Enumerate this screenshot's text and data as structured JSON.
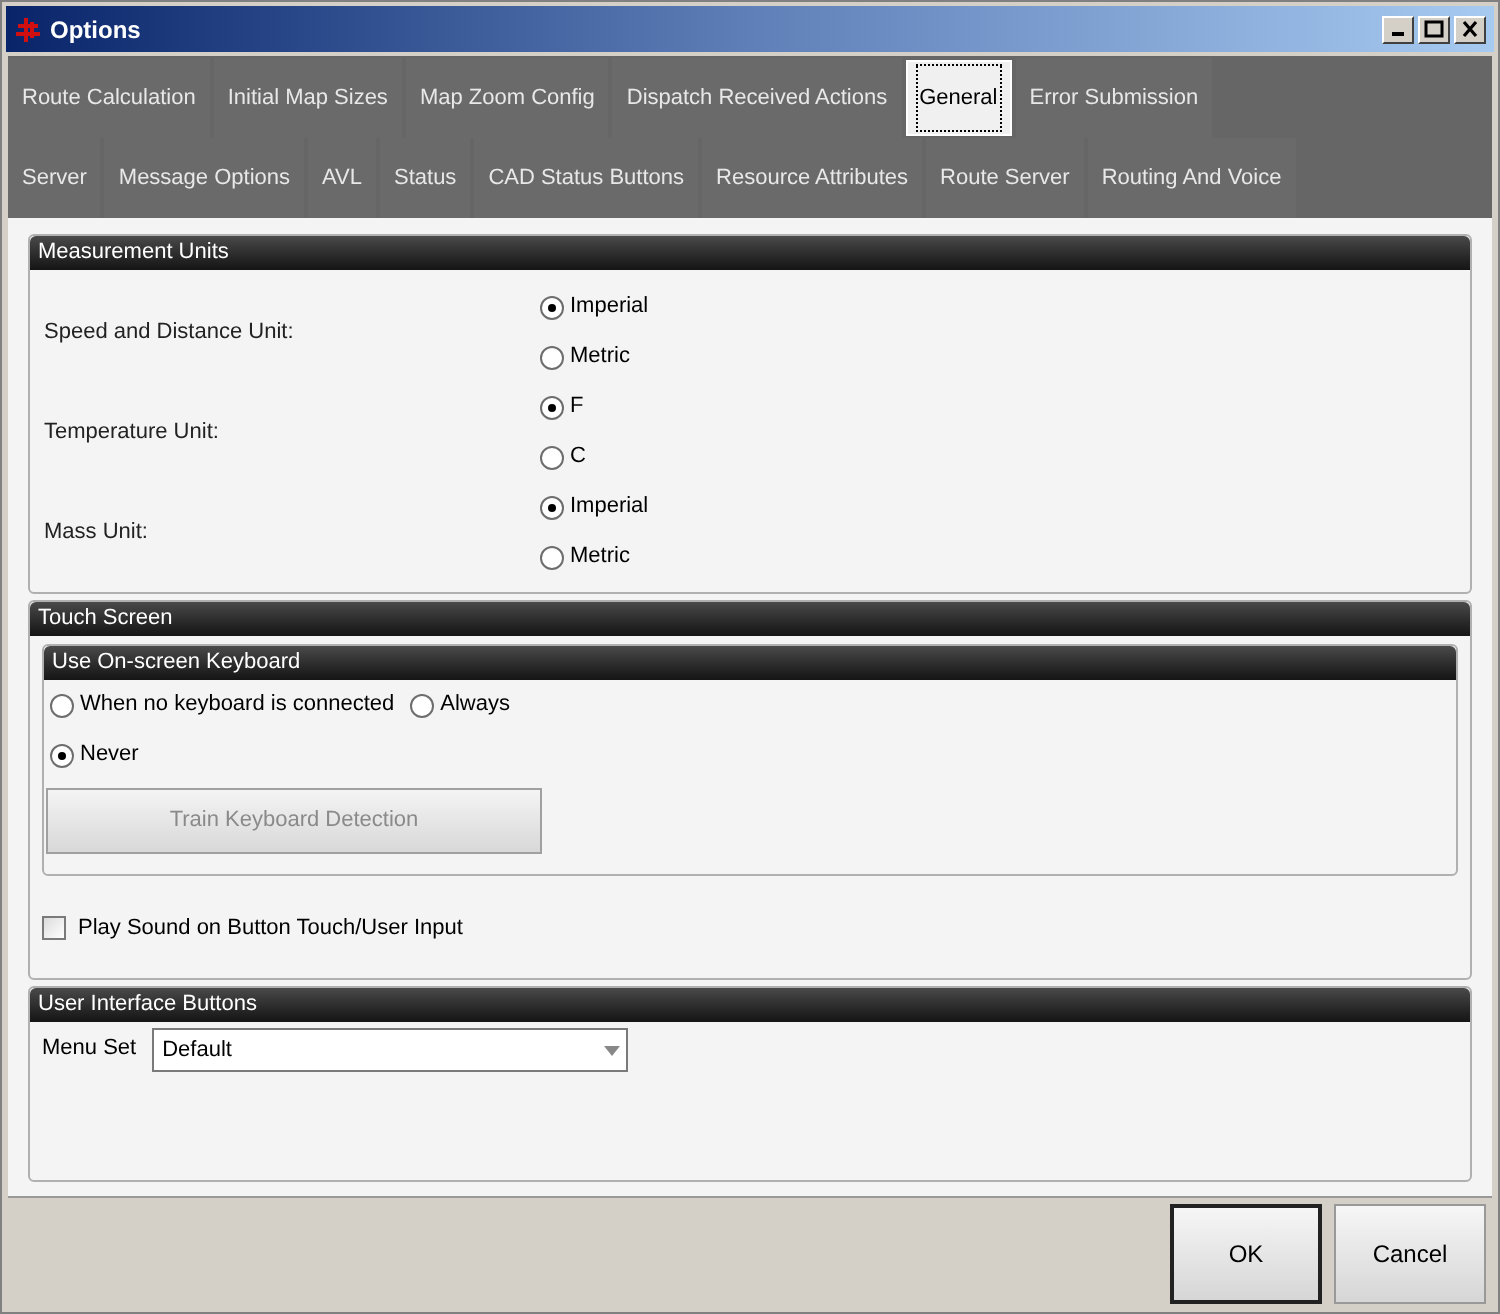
{
  "window": {
    "title": "Options"
  },
  "tab_rows": [
    [
      {
        "label": "Route Calculation",
        "selected": false
      },
      {
        "label": "Initial Map Sizes",
        "selected": false
      },
      {
        "label": "Map Zoom Config",
        "selected": false
      },
      {
        "label": "Dispatch Received Actions",
        "selected": false
      },
      {
        "label": "General",
        "selected": true
      },
      {
        "label": "Error Submission",
        "selected": false
      }
    ],
    [
      {
        "label": "Server",
        "selected": false
      },
      {
        "label": "Message Options",
        "selected": false
      },
      {
        "label": "AVL",
        "selected": false
      },
      {
        "label": "Status",
        "selected": false
      },
      {
        "label": "CAD Status Buttons",
        "selected": false
      },
      {
        "label": "Resource Attributes",
        "selected": false
      },
      {
        "label": "Route Server",
        "selected": false
      },
      {
        "label": "Routing And Voice",
        "selected": false
      }
    ]
  ],
  "measurement_units": {
    "title": "Measurement Units",
    "groups": [
      {
        "label": "Speed and Distance Unit:",
        "options": [
          {
            "label": "Imperial",
            "selected": true
          },
          {
            "label": "Metric",
            "selected": false
          }
        ]
      },
      {
        "label": "Temperature Unit:",
        "options": [
          {
            "label": "F",
            "selected": true
          },
          {
            "label": "C",
            "selected": false
          }
        ]
      },
      {
        "label": "Mass Unit:",
        "options": [
          {
            "label": "Imperial",
            "selected": true
          },
          {
            "label": "Metric",
            "selected": false
          }
        ]
      }
    ]
  },
  "touch_screen": {
    "title": "Touch Screen",
    "keyboard": {
      "title": "Use On-screen Keyboard",
      "options": [
        {
          "label": "When no keyboard is connected",
          "selected": false
        },
        {
          "label": "Always",
          "selected": false
        },
        {
          "label": "Never",
          "selected": true
        }
      ],
      "train_button": {
        "label": "Train Keyboard Detection",
        "disabled": true
      }
    },
    "play_sound": {
      "label": "Play Sound on Button Touch/User Input",
      "checked": false
    }
  },
  "ui_buttons": {
    "title": "User Interface Buttons",
    "menu_set": {
      "label": "Menu Set",
      "value": "Default"
    }
  },
  "buttons": [
    {
      "label": "OK",
      "default": true
    },
    {
      "label": "Cancel",
      "default": false
    }
  ]
}
